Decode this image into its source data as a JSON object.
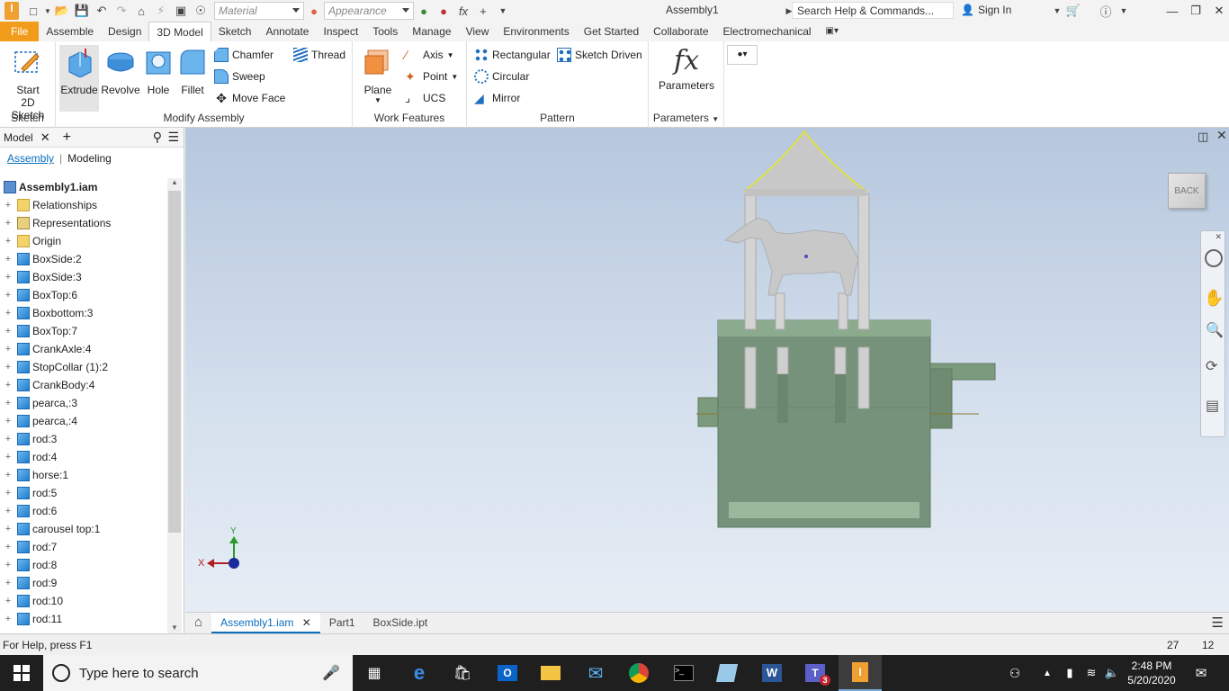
{
  "app": {
    "doc_title": "Assembly1",
    "material_placeholder": "Material",
    "appearance_placeholder": "Appearance",
    "search_placeholder": "Search Help & Commands...",
    "sign_in": "Sign In"
  },
  "tabs": [
    "File",
    "Assemble",
    "Design",
    "3D Model",
    "Sketch",
    "Annotate",
    "Inspect",
    "Tools",
    "Manage",
    "View",
    "Environments",
    "Get Started",
    "Collaborate",
    "Electromechanical"
  ],
  "ribbon": {
    "sketch": {
      "start_line1": "Start",
      "start_line2": "2D Sketch",
      "label": "Sketch"
    },
    "modify": {
      "extrude": "Extrude",
      "revolve": "Revolve",
      "hole": "Hole",
      "fillet": "Fillet",
      "chamfer": "Chamfer",
      "thread": "Thread",
      "sweep": "Sweep",
      "move_face": "Move Face",
      "label": "Modify Assembly"
    },
    "work": {
      "plane": "Plane",
      "axis": "Axis",
      "point": "Point",
      "ucs": "UCS",
      "label": "Work Features"
    },
    "pattern": {
      "rectangular": "Rectangular",
      "sketch_driven": "Sketch Driven",
      "circular": "Circular",
      "mirror": "Mirror",
      "label": "Pattern"
    },
    "parameters": {
      "icon": "fx",
      "parameters": "Parameters",
      "label": "Parameters"
    }
  },
  "panel": {
    "title": "Model",
    "sub_assembly": "Assembly",
    "sub_modeling": "Modeling",
    "root": "Assembly1.iam",
    "nodes": [
      {
        "label": "Relationships",
        "type": "folder"
      },
      {
        "label": "Representations",
        "type": "rep"
      },
      {
        "label": "Origin",
        "type": "folder"
      },
      {
        "label": "BoxSide:2",
        "type": "part"
      },
      {
        "label": "BoxSide:3",
        "type": "part"
      },
      {
        "label": "BoxTop:6",
        "type": "part"
      },
      {
        "label": "Boxbottom:3",
        "type": "part"
      },
      {
        "label": "BoxTop:7",
        "type": "part"
      },
      {
        "label": "CrankAxle:4",
        "type": "part"
      },
      {
        "label": "StopCollar (1):2",
        "type": "part"
      },
      {
        "label": "CrankBody:4",
        "type": "part"
      },
      {
        "label": "pearca,:3",
        "type": "part"
      },
      {
        "label": "pearca,:4",
        "type": "part"
      },
      {
        "label": "rod:3",
        "type": "part"
      },
      {
        "label": "rod:4",
        "type": "part"
      },
      {
        "label": "horse:1",
        "type": "part"
      },
      {
        "label": "rod:5",
        "type": "part"
      },
      {
        "label": "rod:6",
        "type": "part"
      },
      {
        "label": "carousel top:1",
        "type": "part"
      },
      {
        "label": "rod:7",
        "type": "part"
      },
      {
        "label": "rod:8",
        "type": "part"
      },
      {
        "label": "rod:9",
        "type": "part"
      },
      {
        "label": "rod:10",
        "type": "part"
      },
      {
        "label": "rod:11",
        "type": "part"
      }
    ]
  },
  "viewcube": {
    "face": "BACK"
  },
  "triad": {
    "x": "X",
    "y": "Y"
  },
  "doc_tabs": [
    "Assembly1.iam",
    "Part1",
    "BoxSide.ipt"
  ],
  "status": {
    "help": "For Help, press F1",
    "n1": "27",
    "n2": "12"
  },
  "taskbar": {
    "search": "Type here to search",
    "time": "2:48 PM",
    "date": "5/20/2020",
    "teams_badge": "3"
  },
  "colors": {
    "file_tab": "#f29c1c",
    "accent": "#0a6fbf",
    "box": "#76927a",
    "rod": "#d0d0d0"
  }
}
